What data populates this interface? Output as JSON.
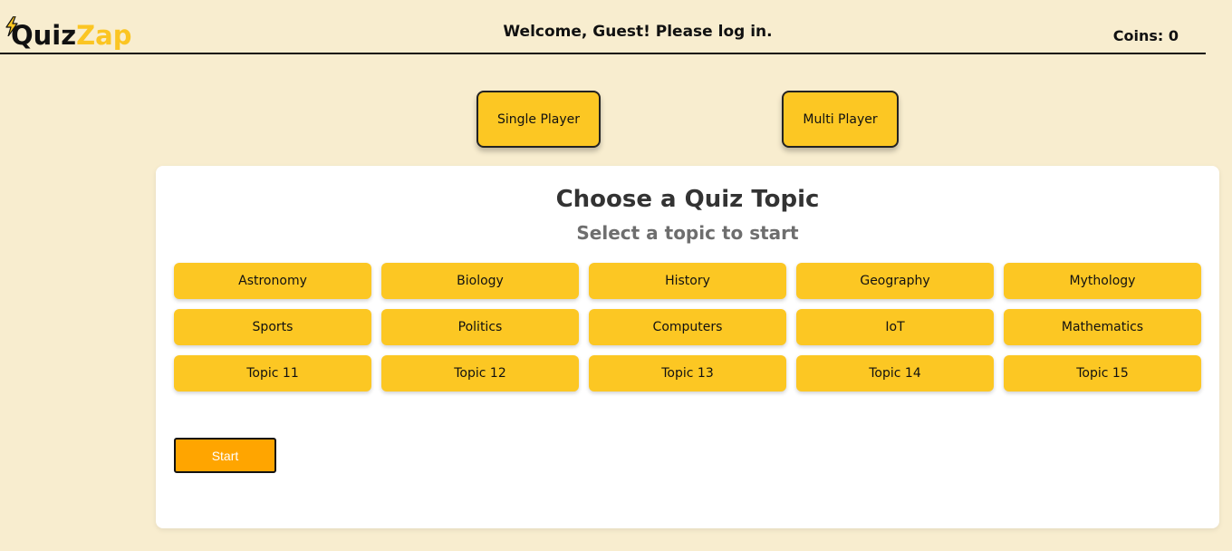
{
  "header": {
    "logo": {
      "part1": "Quiz",
      "part2": "Zap",
      "icon": "lightning-bolt-icon"
    },
    "welcome_text": "Welcome, Guest! Please log in.",
    "coins_text": "Coins: 0"
  },
  "modes": {
    "single_label": "Single Player",
    "multi_label": "Multi Player"
  },
  "card": {
    "title": "Choose a Quiz Topic",
    "subtitle": "Select a topic to start",
    "topics": [
      "Astronomy",
      "Biology",
      "History",
      "Geography",
      "Mythology",
      "Sports",
      "Politics",
      "Computers",
      "IoT",
      "Mathematics",
      "Topic 11",
      "Topic 12",
      "Topic 13",
      "Topic 14",
      "Topic 15"
    ],
    "start_label": "Start"
  },
  "colors": {
    "background": "#f8edcf",
    "accent_yellow": "#fcc723",
    "start_orange": "#ffa500",
    "card": "#ffffff"
  }
}
